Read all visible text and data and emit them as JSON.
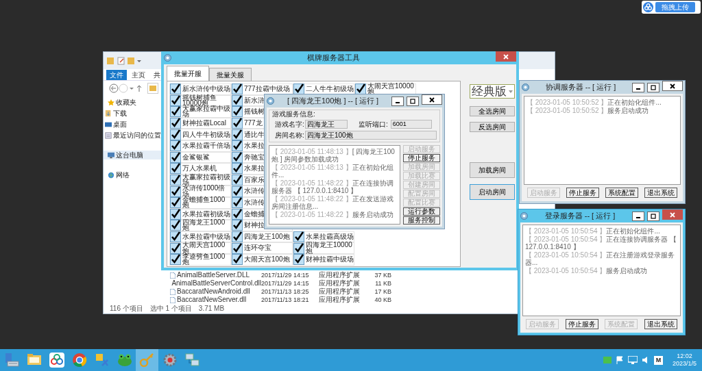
{
  "upload_widget": {
    "label": "拖拽上传"
  },
  "explorer": {
    "ribbon_tabs": [
      {
        "label": "文件",
        "selected": true
      },
      {
        "label": "主页",
        "selected": false
      },
      {
        "label": "共",
        "selected": false
      }
    ],
    "nav": [
      {
        "label": "收藏夹",
        "kind": "star",
        "children": [
          {
            "label": "下载",
            "kind": "download"
          },
          {
            "label": "桌面",
            "kind": "desktop"
          },
          {
            "label": "最近访问的位置",
            "kind": "recent"
          }
        ]
      },
      {
        "label": "这台电脑",
        "kind": "computer",
        "selected": true
      },
      {
        "label": "网络",
        "kind": "network"
      }
    ],
    "files": [
      {
        "name": "AnimalBattleServer.DLL",
        "date": "2017/11/29 14:15",
        "type": "应用程序扩展",
        "size": "37 KB"
      },
      {
        "name": "AnimalBattleServerControl.dll",
        "date": "2017/11/29 14:15",
        "type": "应用程序扩展",
        "size": "11 KB"
      },
      {
        "name": "BaccaratNewAndroid.dll",
        "date": "2017/11/13 18:25",
        "type": "应用程序扩展",
        "size": "17 KB"
      },
      {
        "name": "BaccaratNewServer.dll",
        "date": "2017/11/13 18:21",
        "type": "应用程序扩展",
        "size": "40 KB"
      }
    ],
    "status": [
      "116 个项目",
      "选中 1 个项目",
      "3.71 MB"
    ]
  },
  "main_window": {
    "title": "棋牌服务器工具",
    "active": true,
    "tabs": [
      {
        "label": "批量开服",
        "selected": true
      },
      {
        "label": "批量关服",
        "selected": false
      }
    ],
    "room_rows": [
      [
        {
          "label": "新水浒传中级场",
          "checked": true
        },
        {
          "label": "777拉霸中级场",
          "checked": true
        },
        {
          "label": "二人牛牛初级场",
          "checked": true
        },
        {
          "label": "大闹天宫10000炮",
          "checked": true
        }
      ],
      [
        {
          "label": "摇钱树捕鱼10000炮",
          "checked": true
        },
        {
          "label": "新水浒",
          "checked": true
        }
      ],
      [
        {
          "label": "大赢家拉霸中级场",
          "checked": true
        },
        {
          "label": "摇钱树",
          "checked": true
        }
      ],
      [
        {
          "label": "财神拉霸Local",
          "checked": true
        },
        {
          "label": "777龙",
          "checked": true
        }
      ],
      [
        {
          "label": "四人牛牛初级场",
          "checked": true
        },
        {
          "label": "通比牛",
          "checked": true
        }
      ],
      [
        {
          "label": "水果拉霸千倍场",
          "checked": true
        },
        {
          "label": "水果拉",
          "checked": true
        }
      ],
      [
        {
          "label": "金鲨银鲨",
          "checked": true
        },
        {
          "label": "奔驰宝",
          "checked": true
        }
      ],
      [
        {
          "label": "万人水果机",
          "checked": true
        },
        {
          "label": "水果拉",
          "checked": true
        }
      ],
      [
        {
          "label": "大赢家拉霸初级场",
          "checked": true
        },
        {
          "label": "百家乐",
          "checked": true
        }
      ],
      [
        {
          "label": "水浒传1000倍场",
          "checked": true
        },
        {
          "label": "水浒传",
          "checked": true
        }
      ],
      [
        {
          "label": "金蟾捕鱼1000炮",
          "checked": true
        },
        {
          "label": "水浒传",
          "checked": true
        }
      ],
      [
        {
          "label": "水果拉霸初级场",
          "checked": true
        },
        {
          "label": "金蟾捕",
          "checked": true
        }
      ],
      [
        {
          "label": "四海龙王1000炮",
          "checked": true
        },
        {
          "label": "财神拉",
          "checked": true
        }
      ],
      [
        {
          "label": "水果拉霸中级场",
          "checked": true
        },
        {
          "label": "四海龙王100炮",
          "checked": true
        },
        {
          "label": "水果拉霸高级场",
          "checked": true
        }
      ],
      [
        {
          "label": "大闹天宫1000炮",
          "checked": true
        },
        {
          "label": "连环夺宝",
          "checked": true
        },
        {
          "label": "四海龙王10000炮",
          "checked": true
        }
      ],
      [
        {
          "label": "李逵劈鱼1000炮",
          "checked": true
        },
        {
          "label": "大闹天宫100炮",
          "checked": true
        },
        {
          "label": "财神拉霸中级场",
          "checked": true
        }
      ]
    ],
    "edition": "经典版",
    "buttons": [
      {
        "label": "全选房间",
        "focused": false
      },
      {
        "label": "反选房间",
        "focused": false
      },
      {
        "label": "加载房间",
        "focused": false
      },
      {
        "label": "启动房间",
        "focused": true
      }
    ]
  },
  "room_dialog": {
    "title": "[ 四海龙王100炮 ] -- [ 运行 ]",
    "active": false,
    "group_title": "游戏服务信息:",
    "fields": [
      {
        "label": "游戏名字:",
        "value": "四海龙王"
      },
      {
        "label": "监听端口:",
        "value": "6001"
      },
      {
        "label": "房间名称:",
        "value": "四海龙王100炮"
      }
    ],
    "log": [
      {
        "time": "【 2023-01-05 11:48:13 】",
        "message": "[ 四海龙王100炮 ] 房间参数加载成功"
      },
      {
        "time": "【 2023-01-05 11:48:13 】",
        "message": "正在初始化组件..."
      },
      {
        "time": "【 2023-01-05 11:48:22 】",
        "message": "正在连接协调服务器 【 127.0.0.1:8410 】"
      },
      {
        "time": "【 2023-01-05 11:48:22 】",
        "message": "正在发送游戏房间注册信息..."
      },
      {
        "time": "【 2023-01-05 11:48:22 】",
        "message": "服务启动成功"
      }
    ],
    "buttons": [
      {
        "label": "启动服务",
        "disabled": true
      },
      {
        "label": "停止服务",
        "disabled": false
      },
      {
        "label": "加载房间",
        "disabled": true
      },
      {
        "label": "加载比赛",
        "disabled": true
      },
      {
        "label": "创建房间",
        "disabled": true
      },
      {
        "label": "配置房间",
        "disabled": true
      },
      {
        "label": "配置比赛",
        "disabled": true
      },
      {
        "label": "运行参数",
        "disabled": false
      },
      {
        "label": "服务控制",
        "disabled": false
      }
    ]
  },
  "coord_window": {
    "title": "协调服务器 -- [ 运行 ]",
    "active": false,
    "log": [
      {
        "time": "【 2023-01-05 10:50:52 】",
        "message": "正在初始化组件..."
      },
      {
        "time": "【 2023-01-05 10:50:52 】",
        "message": "服务启动成功"
      }
    ],
    "buttons": [
      {
        "label": "启动服务",
        "disabled": true
      },
      {
        "label": "停止服务",
        "disabled": false
      },
      {
        "label": "系统配置",
        "disabled": false
      },
      {
        "label": "退出系统",
        "disabled": false
      }
    ]
  },
  "login_window": {
    "title": "登录服务器 -- [ 运行 ]",
    "active": true,
    "log": [
      {
        "time": "【 2023-01-05 10:50:54 】",
        "message": "正在初始化组件..."
      },
      {
        "time": "【 2023-01-05 10:50:54 】",
        "message": "正在连接协调服务器 【 127.0.0.1:8410 】"
      },
      {
        "time": "【 2023-01-05 10:50:54 】",
        "message": "正在注册游戏登录服务器..."
      },
      {
        "time": "【 2023-01-05 10:50:54 】",
        "message": "服务启动成功"
      }
    ],
    "buttons": [
      {
        "label": "启动服务",
        "disabled": true
      },
      {
        "label": "停止服务",
        "disabled": false
      },
      {
        "label": "系统配置",
        "disabled": true
      },
      {
        "label": "退出系统",
        "disabled": false
      }
    ]
  },
  "taskbar": {
    "apps": [
      {
        "kind": "server",
        "active": false
      },
      {
        "kind": "folder",
        "active": false
      },
      {
        "kind": "cloud",
        "active": false
      },
      {
        "kind": "browser",
        "active": false
      },
      {
        "kind": "tool",
        "active": false
      },
      {
        "kind": "frog",
        "active": false
      },
      {
        "kind": "key",
        "active": true
      },
      {
        "kind": "gear",
        "active": false
      },
      {
        "kind": "network",
        "active": false
      }
    ],
    "ime": "M",
    "time": "12:02",
    "date": "2023/1/5"
  }
}
